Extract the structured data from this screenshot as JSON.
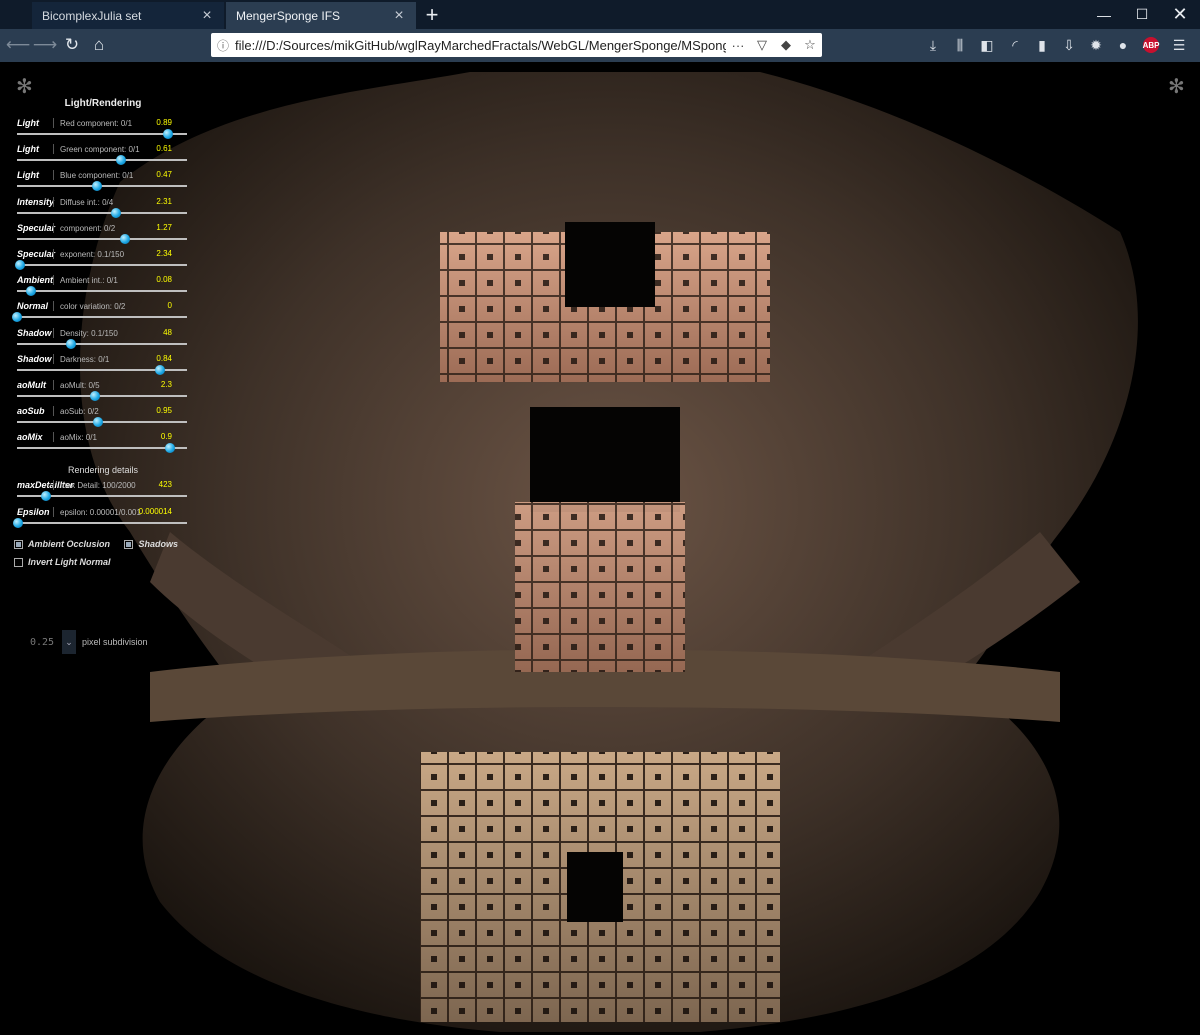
{
  "browser": {
    "tabs": [
      {
        "title": "BicomplexJulia set",
        "active": false
      },
      {
        "title": "MengerSponge IFS",
        "active": true
      }
    ],
    "url": "file:///D:/Sources/mikGitHub/wglRayMarchedFractals/WebGL/MengerSponge/MSponge.htm",
    "toolbar_icons": [
      "download-icon",
      "library-icon",
      "sidebar-icon",
      "speedometer-icon",
      "extension-icon",
      "download-arrow-icon",
      "gear-icon",
      "colors-icon",
      "abp-icon",
      "menu-icon"
    ],
    "abp_label": "ABP"
  },
  "panel": {
    "title": "Light/Rendering",
    "sliders": [
      {
        "name": "Light",
        "desc": "Red component: 0/1",
        "value": "0.89",
        "fraction": 0.89
      },
      {
        "name": "Light",
        "desc": "Green component: 0/1",
        "value": "0.61",
        "fraction": 0.61
      },
      {
        "name": "Light",
        "desc": "Blue component: 0/1",
        "value": "0.47",
        "fraction": 0.47
      },
      {
        "name": "Intensity",
        "desc": "Diffuse int.: 0/4",
        "value": "2.31",
        "fraction": 0.58
      },
      {
        "name": "Specular",
        "desc": "component: 0/2",
        "value": "1.27",
        "fraction": 0.635
      },
      {
        "name": "Specular",
        "desc": "exponent: 0.1/150",
        "value": "2.34",
        "fraction": 0.015
      },
      {
        "name": "Ambient",
        "desc": "Ambient int.: 0/1",
        "value": "0.08",
        "fraction": 0.08
      },
      {
        "name": "Normal",
        "desc": "color variation: 0/2",
        "value": "0",
        "fraction": 0.0
      },
      {
        "name": "Shadow",
        "desc": "Density: 0.1/150",
        "value": "48",
        "fraction": 0.32
      },
      {
        "name": "Shadow",
        "desc": "Darkness: 0/1",
        "value": "0.84",
        "fraction": 0.84
      },
      {
        "name": "aoMult",
        "desc": "aoMult: 0/5",
        "value": "2.3",
        "fraction": 0.46
      },
      {
        "name": "aoSub",
        "desc": "aoSub: 0/2",
        "value": "0.95",
        "fraction": 0.475
      },
      {
        "name": "aoMix",
        "desc": "aoMix: 0/1",
        "value": "0.9",
        "fraction": 0.9
      }
    ],
    "details_title": "Rendering details",
    "details": [
      {
        "name": "maxDetailIter",
        "desc": "max Detail: 100/2000",
        "value": "423",
        "fraction": 0.17
      },
      {
        "name": "Epsilon",
        "desc": "epsilon: 0.00001/0.001",
        "value": "0.000014",
        "fraction": 0.004
      }
    ],
    "checkboxes": [
      {
        "label": "Ambient Occlusion",
        "checked": true
      },
      {
        "label": "Shadows",
        "checked": true
      },
      {
        "label": "Invert Light Normal",
        "checked": false
      }
    ],
    "subdivision": {
      "value": "0.25",
      "label": "pixel subdivision"
    }
  },
  "colors": {
    "accent_value": "#ffff00",
    "knob": "#1ba7e5",
    "tabbar": "#0f1b2a",
    "navbar": "#2b3d51"
  }
}
